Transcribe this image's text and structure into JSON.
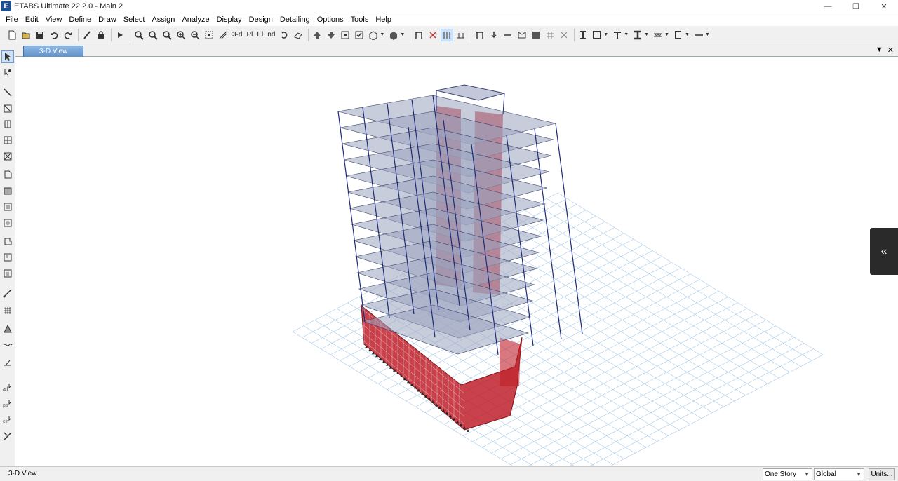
{
  "window": {
    "title": "ETABS Ultimate 22.2.0 - Main 2",
    "app_icon": "E"
  },
  "menu": [
    "File",
    "Edit",
    "View",
    "Define",
    "Draw",
    "Select",
    "Assign",
    "Analyze",
    "Display",
    "Design",
    "Detailing",
    "Options",
    "Tools",
    "Help"
  ],
  "toolbar": {
    "view_3d_label": "3-d",
    "plan_label": "Pl",
    "elev_label": "El",
    "nd_label": "nd"
  },
  "tab": {
    "label": "3-D View"
  },
  "status": {
    "text": "3-D View",
    "story_option": "One Story",
    "coord_system": "Global",
    "units_label": "Units..."
  },
  "colors": {
    "accent": "#5f92cc",
    "frame": "#1e2a78",
    "wall": "#c0202a",
    "slab": "#9aa4bf",
    "grid": "#a8c8e8"
  }
}
